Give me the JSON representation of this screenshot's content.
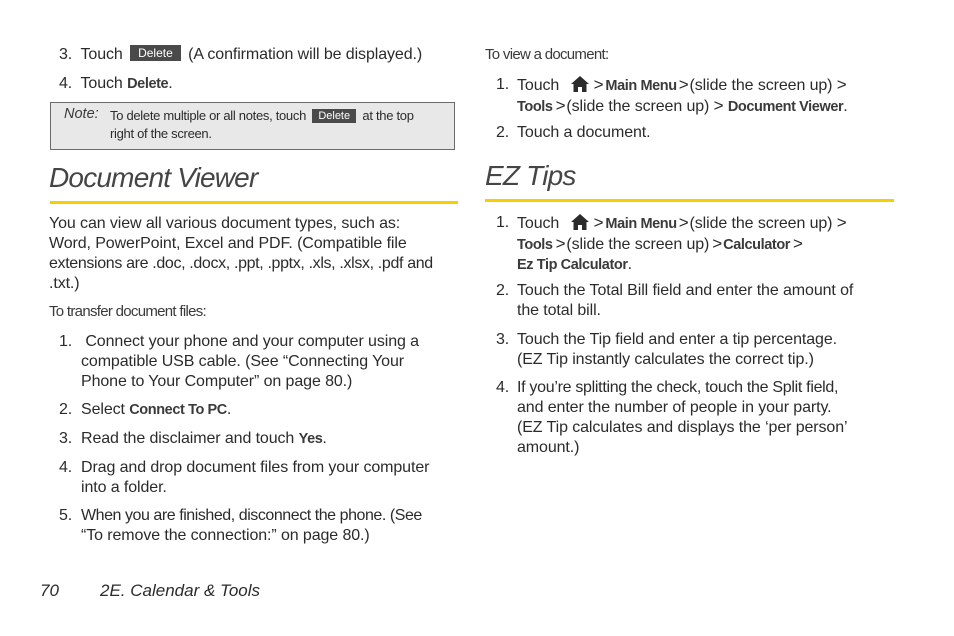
{
  "top_steps": [
    {
      "num": "3.",
      "pre": "Touch",
      "button": "Delete",
      "post": "(A confirmation will be displayed.)"
    },
    {
      "num": "4.",
      "pre": "Touch",
      "bold": "Delete",
      "post": "."
    }
  ],
  "note": {
    "label": "Note:",
    "line1_pre": "To delete multiple or all notes, touch",
    "button": "Delete",
    "line1_post": "at the top",
    "line2": "right of the screen."
  },
  "document_viewer": {
    "title": "Document Viewer",
    "intro": [
      "You can view all various document types, such as:",
      "Word, PowerPoint, Excel and PDF. (Compatible file",
      "extensions are .doc, .docx, .ppt, .pptx, .xls, .xlsx, .pdf and",
      ".txt.)"
    ],
    "transfer_heading": "To transfer document files:",
    "transfer_steps": [
      {
        "num": "1.",
        "lines": [
          " Connect your phone and your computer using a",
          "compatible USB cable. (See “Connecting Your",
          "Phone to Your Computer” on page 80.)"
        ]
      },
      {
        "num": "2.",
        "pre": "Select",
        "bold": "Connect To PC",
        "post": "."
      },
      {
        "num": "3.",
        "pre": "Read the disclaimer and touch",
        "bold": "Yes",
        "post": "."
      },
      {
        "num": "4.",
        "lines": [
          "Drag and drop document files from your computer",
          "into a folder."
        ]
      },
      {
        "num": "5.",
        "lines": [
          "When you are finished, disconnect the phone. (See",
          "“To remove the connection:” on page 80.)"
        ]
      }
    ],
    "view_heading": "To view a document:",
    "view_steps": [
      {
        "num": "1.",
        "touch": "Touch",
        "icon": "home-icon",
        "sep": ">",
        "main_menu": "Main Menu",
        "slide": "(slide the screen up)",
        "tools": "Tools",
        "target": "Document Viewer",
        "end": "."
      },
      {
        "num": "2.",
        "text": "Touch a document."
      }
    ]
  },
  "ez_tips": {
    "title": "EZ Tips",
    "steps": [
      {
        "num": "1.",
        "touch": "Touch",
        "icon": "home-icon",
        "sep": ">",
        "main_menu": "Main Menu",
        "slide": "(slide the screen up)",
        "tools": "Tools",
        "calculator": "Calculator",
        "target": "Ez Tip Calculator",
        "end": "."
      },
      {
        "num": "2.",
        "lines": [
          "Touch the Total Bill field and enter the amount of",
          "the total bill."
        ]
      },
      {
        "num": "3.",
        "lines": [
          "Touch the Tip field and enter a tip percentage.",
          "(EZ Tip instantly calculates the correct tip.)"
        ]
      },
      {
        "num": "4.",
        "lines": [
          "If you’re splitting the check, touch the Split field,",
          "and enter the number of people in your party.",
          "(EZ Tip calculates and displays the ‘per person’",
          "amount.)"
        ]
      }
    ]
  },
  "footer": {
    "page_number": "70",
    "section": "2E. Calendar & Tools"
  },
  "colors": {
    "rule": "#f5cf00",
    "button_bg": "#4a4a4a",
    "note_bg": "#e8e8e8"
  }
}
